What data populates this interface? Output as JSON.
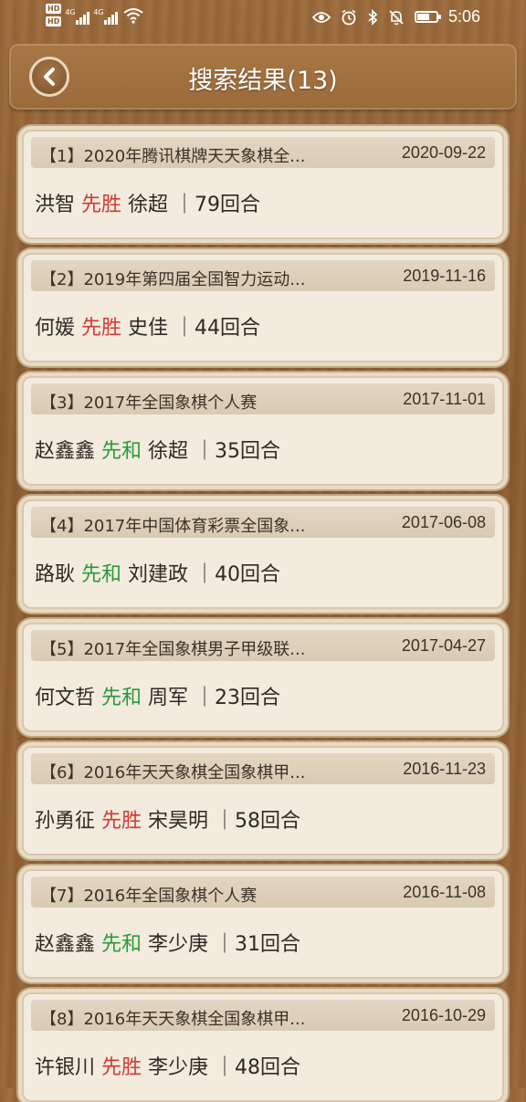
{
  "status_bar": {
    "hd1": "HD",
    "hd2": "HD",
    "signal1_label": "4G",
    "signal2_label": "4G",
    "time": "5:06",
    "battery_level": 0.65
  },
  "header": {
    "title": "搜索结果(13)",
    "back_icon": "chevron-left-icon"
  },
  "colors": {
    "win": "#d23a32",
    "draw": "#2a9a3a"
  },
  "games": [
    {
      "title": "【1】2020年腾讯棋牌天天象棋全...",
      "date": "2020-09-22",
      "red": "洪智",
      "result": "先胜",
      "black": "徐超",
      "moves": "｜79回合"
    },
    {
      "title": "【2】2019年第四届全国智力运动...",
      "date": "2019-11-16",
      "red": "何媛",
      "result": "先胜",
      "black": "史佳",
      "moves": "｜44回合"
    },
    {
      "title": "【3】2017年全国象棋个人赛",
      "date": "2017-11-01",
      "red": "赵鑫鑫",
      "result": "先和",
      "black": "徐超",
      "moves": "｜35回合"
    },
    {
      "title": "【4】2017年中国体育彩票全国象...",
      "date": "2017-06-08",
      "red": "路耿",
      "result": "先和",
      "black": "刘建政",
      "moves": "｜40回合"
    },
    {
      "title": "【5】2017年全国象棋男子甲级联...",
      "date": "2017-04-27",
      "red": "何文哲",
      "result": "先和",
      "black": "周军",
      "moves": "｜23回合"
    },
    {
      "title": "【6】2016年天天象棋全国象棋甲...",
      "date": "2016-11-23",
      "red": "孙勇征",
      "result": "先胜",
      "black": "宋昊明",
      "moves": "｜58回合"
    },
    {
      "title": "【7】2016年全国象棋个人赛",
      "date": "2016-11-08",
      "red": "赵鑫鑫",
      "result": "先和",
      "black": "李少庚",
      "moves": "｜31回合"
    },
    {
      "title": "【8】2016年天天象棋全国象棋甲...",
      "date": "2016-10-29",
      "red": "许银川",
      "result": "先胜",
      "black": "李少庚",
      "moves": "｜48回合"
    }
  ]
}
